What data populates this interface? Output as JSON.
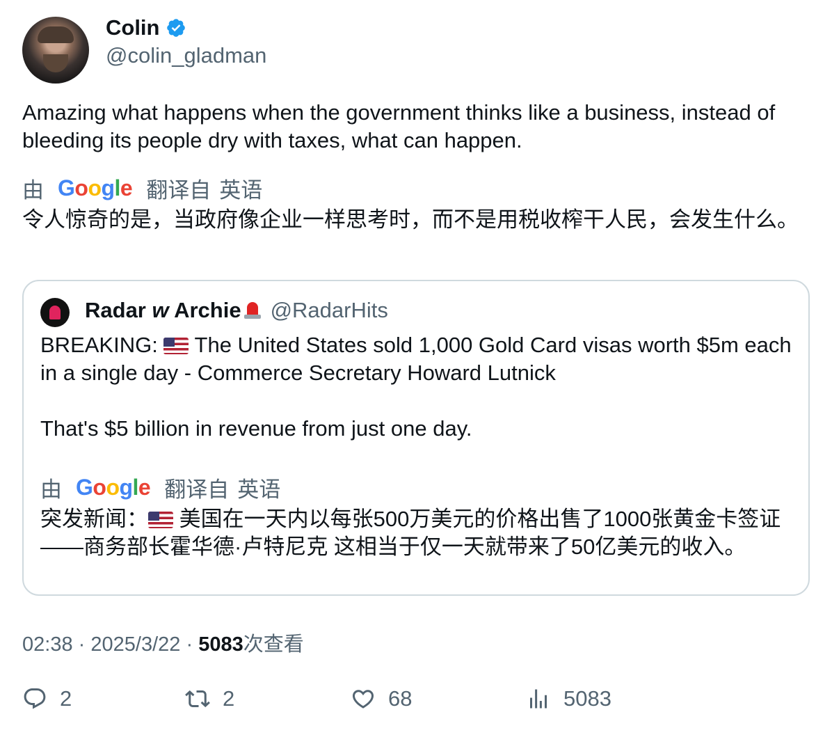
{
  "author": {
    "name": "Colin",
    "handle": "@colin_gladman"
  },
  "tweet": {
    "text": "Amazing what happens when the government thinks like a business, instead of bleeding its people dry with taxes, what can happen.",
    "translation_prefix": "由",
    "translation_provider": "Google",
    "translation_from": "翻译自",
    "translation_lang": "英语",
    "translated_text": "令人惊奇的是，当政府像企业一样思考时，而不是用税收榨干人民，会发生什么。"
  },
  "quote": {
    "name_part1": "Radar",
    "name_part2": "w",
    "name_part3": "Archie",
    "handle": "@RadarHits",
    "text_prefix": "BREAKING:",
    "text_main": "The United States sold 1,000 Gold Card visas worth $5m each in a single day - Commerce Secretary Howard Lutnick",
    "text_second": "That's $5 billion in revenue from just one day.",
    "translation_prefix": "由",
    "translation_provider": "Google",
    "translation_from": "翻译自",
    "translation_lang": "英语",
    "translated_prefix": "突发新闻：",
    "translated_main": "美国在一天内以每张500万美元的价格出售了1000张黄金卡签证——商务部长霍华德·卢特尼克 这相当于仅一天就带来了50亿美元的收入。"
  },
  "meta": {
    "time": "02:38",
    "sep1": "·",
    "date": "2025/3/22",
    "sep2": "·",
    "views_count": "5083",
    "views_label": "次查看"
  },
  "actions": {
    "replies": "2",
    "retweets": "2",
    "likes": "68",
    "views": "5083"
  },
  "colors": {
    "verified": "#1d9bf0",
    "secondary_text": "#536471",
    "border": "#cfd9de"
  }
}
